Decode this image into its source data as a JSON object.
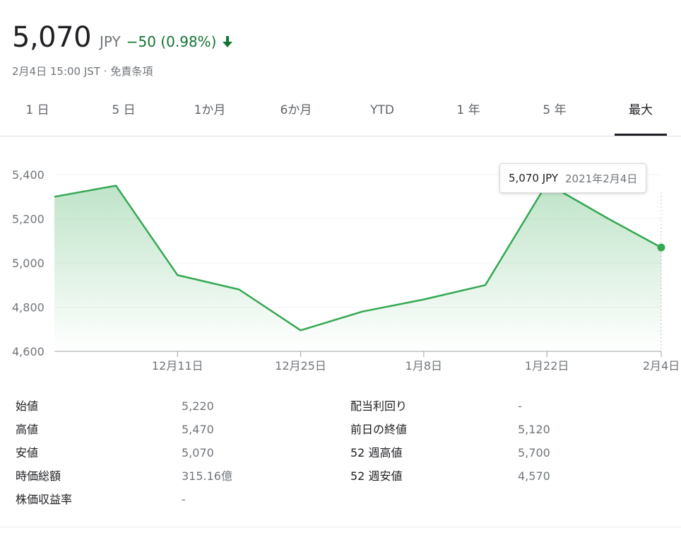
{
  "quote": {
    "price": "5,070",
    "currency": "JPY",
    "change": "−50 (0.98%)",
    "timestamp": "2月4日 15:00 JST",
    "separator": "·",
    "disclaimer": "免責条項",
    "change_color": "#137333"
  },
  "tabs": [
    {
      "label": "1 日",
      "active": false
    },
    {
      "label": "5 日",
      "active": false
    },
    {
      "label": "1か月",
      "active": false
    },
    {
      "label": "6か月",
      "active": false
    },
    {
      "label": "YTD",
      "active": false
    },
    {
      "label": "1 年",
      "active": false
    },
    {
      "label": "5 年",
      "active": false
    },
    {
      "label": "最大",
      "active": true
    }
  ],
  "tooltip": {
    "value": "5,070 JPY",
    "date": "2021年2月4日"
  },
  "chart_data": {
    "type": "area",
    "title": "",
    "xlabel": "",
    "ylabel": "",
    "x": [
      "2020-11-27",
      "2020-12-04",
      "2020-12-11",
      "2020-12-18",
      "2020-12-25",
      "2021-01-01",
      "2021-01-08",
      "2021-01-15",
      "2021-01-22",
      "2021-01-29",
      "2021-02-04"
    ],
    "values": [
      5300,
      5350,
      4945,
      4880,
      4695,
      4780,
      4835,
      4900,
      5360,
      5200,
      5070
    ],
    "x_ticks": [
      "12月11日",
      "12月25日",
      "1月8日",
      "1月22日",
      "2月4日"
    ],
    "y_ticks": [
      "5,400",
      "5,200",
      "5,000",
      "4,800",
      "4,600"
    ],
    "y_tick_values": [
      5400,
      5200,
      5000,
      4800,
      4600
    ],
    "ylim": [
      4600,
      5480
    ],
    "color": "#34a853",
    "grid": true,
    "last_point_marker": true
  },
  "stats": {
    "left": [
      {
        "label": "始値",
        "value": "5,220"
      },
      {
        "label": "高値",
        "value": "5,470"
      },
      {
        "label": "安値",
        "value": "5,070"
      },
      {
        "label": "時価総額",
        "value": "315.16億"
      },
      {
        "label": "株価収益率",
        "value": "-"
      }
    ],
    "right": [
      {
        "label": "配当利回り",
        "value": "-"
      },
      {
        "label": "前日の終値",
        "value": "5,120"
      },
      {
        "label": "52 週高値",
        "value": "5,700"
      },
      {
        "label": "52 週安値",
        "value": "4,570"
      }
    ]
  }
}
